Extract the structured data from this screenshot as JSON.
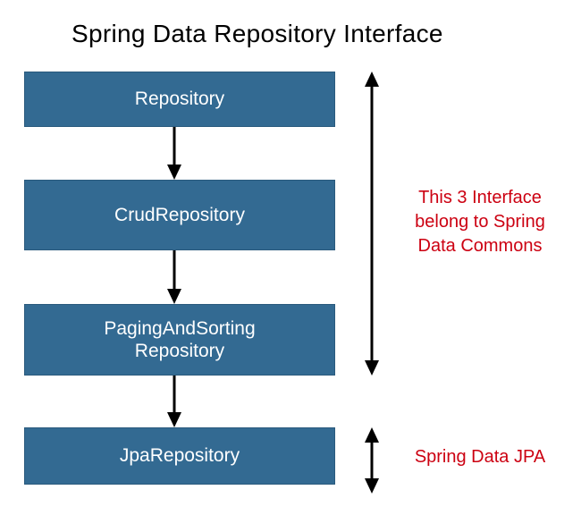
{
  "title": "Spring Data Repository Interface",
  "boxes": {
    "repository": "Repository",
    "crud": "CrudRepository",
    "paging": "PagingAndSorting\nRepository",
    "jpa": "JpaRepository"
  },
  "annotations": {
    "commons": "This 3 Interface belong to Spring Data Commons",
    "jpa": "Spring Data JPA"
  },
  "colors": {
    "box_bg": "#336a92",
    "box_text": "#ffffff",
    "annotation": "#cc0011"
  }
}
